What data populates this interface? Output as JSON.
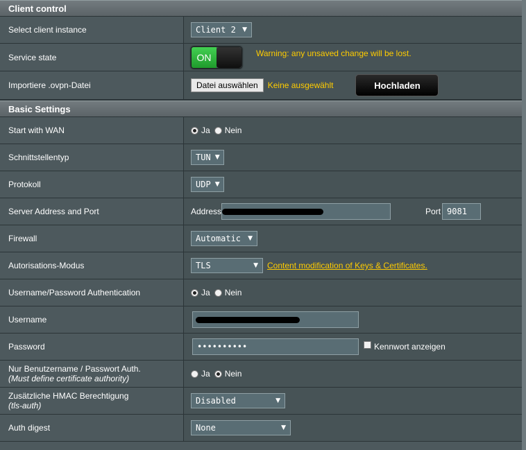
{
  "client_control": {
    "header": "Client control",
    "select_instance": {
      "label": "Select client instance",
      "value": "Client 2"
    },
    "service_state": {
      "label": "Service state",
      "toggle_label": "ON",
      "warning": "Warning: any unsaved change will be lost."
    },
    "import_ovpn": {
      "label": "Importiere .ovpn-Datei",
      "choose_button": "Datei auswählen",
      "no_file": "Keine ausgewählt",
      "upload_button": "Hochladen"
    }
  },
  "basic_settings": {
    "header": "Basic Settings",
    "start_with_wan": {
      "label": "Start with WAN",
      "options": [
        "Ja",
        "Nein"
      ],
      "selected": "Ja"
    },
    "interface_type": {
      "label": "Schnittstellentyp",
      "value": "TUN"
    },
    "protocol": {
      "label": "Protokoll",
      "value": "UDP"
    },
    "server": {
      "label": "Server Address and Port",
      "address_label": "Address",
      "port_label": "Port",
      "port_value": "9081"
    },
    "firewall": {
      "label": "Firewall",
      "value": "Automatic"
    },
    "auth_mode": {
      "label": "Autorisations-Modus",
      "value": "TLS",
      "link": "Content modification of Keys & Certificates."
    },
    "userpass_auth": {
      "label": "Username/Password Authentication",
      "options": [
        "Ja",
        "Nein"
      ],
      "selected": "Ja"
    },
    "username": {
      "label": "Username"
    },
    "password": {
      "label": "Password",
      "value": "••••••••••",
      "show_label": "Kennwort anzeigen"
    },
    "userpass_only": {
      "label": "Nur Benutzername / Passwort Auth.",
      "sublabel": "(Must define certificate authority)",
      "options": [
        "Ja",
        "Nein"
      ],
      "selected": "Nein"
    },
    "hmac": {
      "label": "Zusätzliche HMAC Berechtigung",
      "sublabel": "(tls-auth)",
      "value": "Disabled"
    },
    "auth_digest": {
      "label": "Auth digest",
      "value": "None"
    }
  }
}
